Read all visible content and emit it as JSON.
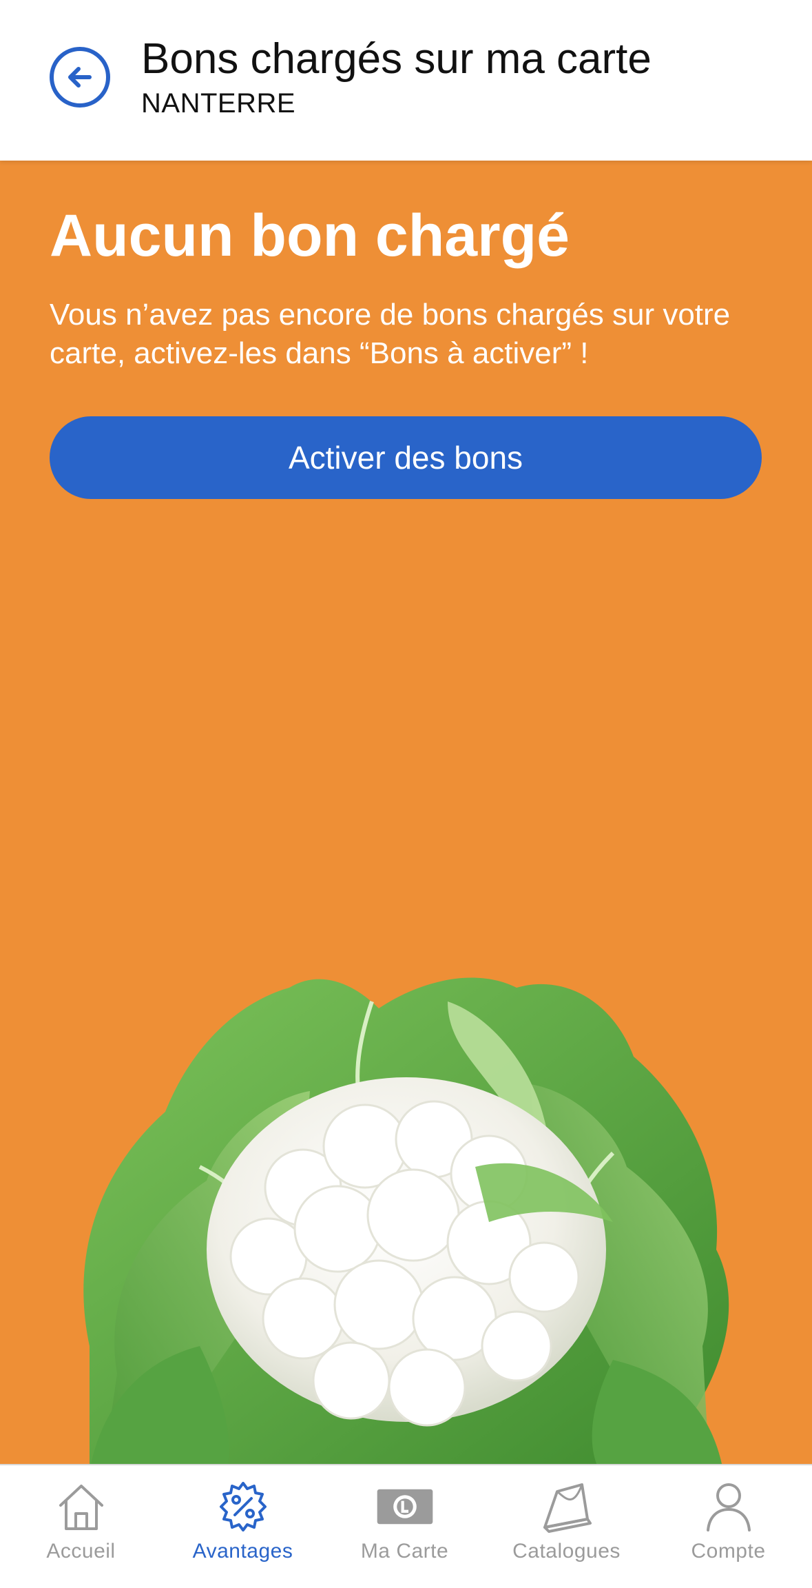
{
  "header": {
    "title": "Bons chargés sur ma carte",
    "subtitle": "NANTERRE",
    "back_icon": "arrow-left-circle-icon"
  },
  "main": {
    "title": "Aucun bon chargé",
    "message": "Vous n’avez pas encore de bons chargés sur votre carte, activez-les dans “Bons à activer” !",
    "button_label": "Activer des bons",
    "illustration": "cauliflower-illustration"
  },
  "tabs": [
    {
      "label": "Accueil",
      "icon": "home-icon",
      "active": false
    },
    {
      "label": "Avantages",
      "icon": "discount-badge-icon",
      "active": true
    },
    {
      "label": "Ma Carte",
      "icon": "loyalty-card-icon",
      "active": false
    },
    {
      "label": "Catalogues",
      "icon": "catalog-icon",
      "active": false
    },
    {
      "label": "Compte",
      "icon": "user-icon",
      "active": false
    }
  ],
  "colors": {
    "accent_blue": "#2964c9",
    "background_orange": "#ee8f36",
    "tab_inactive": "#9b9b9b"
  }
}
